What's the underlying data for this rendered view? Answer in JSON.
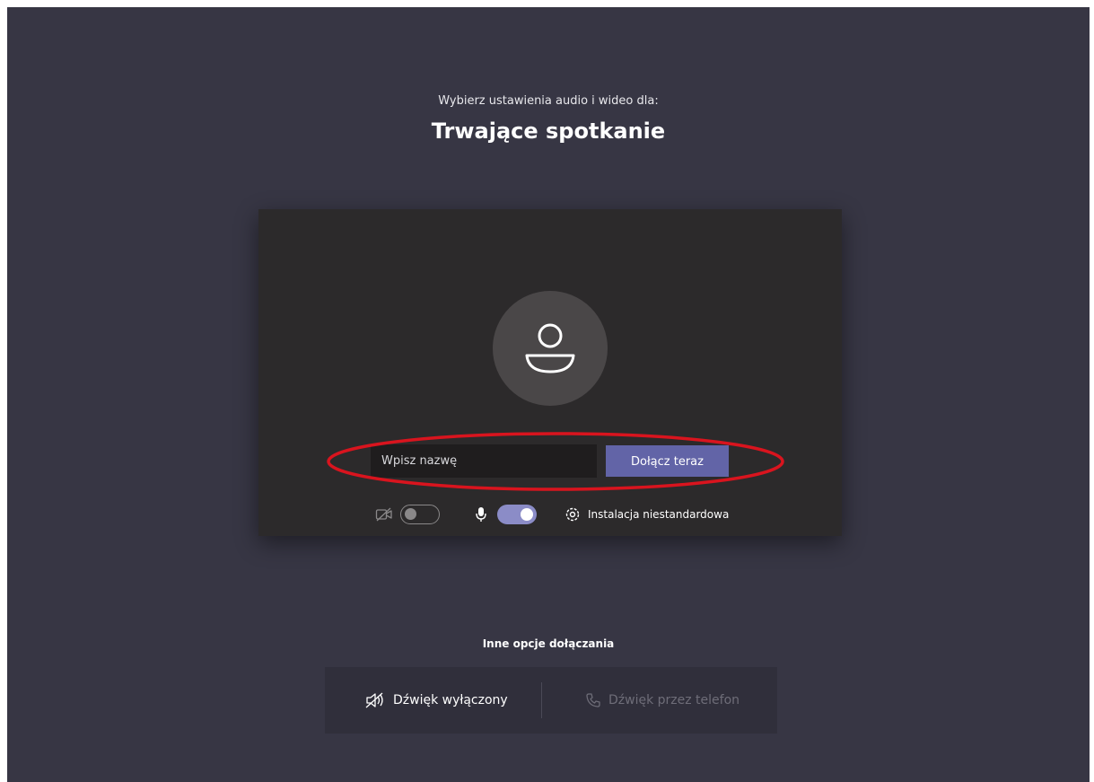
{
  "header": {
    "subtitle": "Wybierz ustawienia audio i wideo dla:",
    "title": "Trwające spotkanie"
  },
  "prejoin": {
    "name_placeholder": "Wpisz nazwę",
    "join_label": "Dołącz teraz",
    "video_toggle_on": false,
    "mic_toggle_on": true,
    "custom_setup_label": "Instalacja niestandardowa"
  },
  "other_options": {
    "label": "Inne opcje dołączania",
    "audio_off_label": "Dźwięk wyłączony",
    "phone_audio_label": "Dźwięk przez telefon"
  },
  "colors": {
    "background": "#373644",
    "panel": "#2c2a2b",
    "accent": "#6264a7",
    "highlight_ring": "#d9141e"
  },
  "icons": {
    "avatar": "person-icon",
    "video": "video-off-icon",
    "mic": "microphone-icon",
    "settings": "gear-icon",
    "speaker": "speaker-off-icon",
    "phone": "phone-icon"
  }
}
